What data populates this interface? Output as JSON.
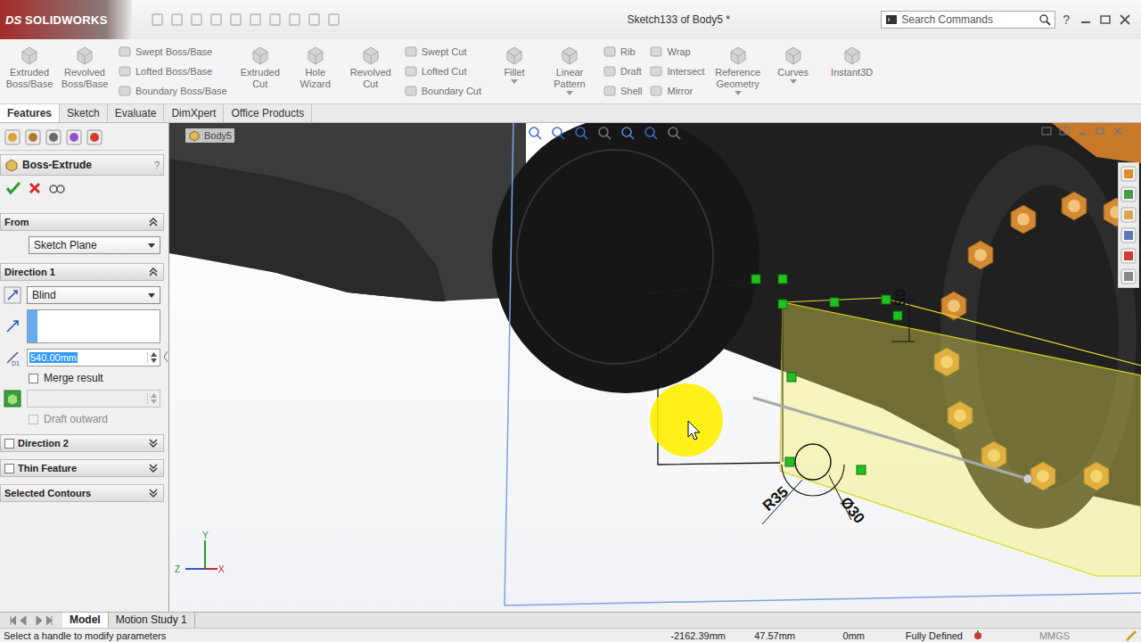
{
  "app": {
    "logo_mark": "DS",
    "logo": "SOLIDWORKS"
  },
  "window": {
    "title": "Sketch133 of Body5 *"
  },
  "search": {
    "placeholder": "Search Commands"
  },
  "help": "?",
  "ribbon": {
    "groups": [
      {
        "kind": "large",
        "items": [
          {
            "label": "Extruded Boss/Base",
            "disabled": true,
            "dropdown": false
          },
          {
            "label": "Revolved Boss/Base",
            "disabled": true,
            "dropdown": false
          }
        ]
      },
      {
        "kind": "stack",
        "items": [
          {
            "label": "Swept Boss/Base",
            "disabled": true,
            "dropdown": false
          },
          {
            "label": "Lofted Boss/Base",
            "disabled": true,
            "dropdown": false
          },
          {
            "label": "Boundary Boss/Base",
            "disabled": true,
            "dropdown": false
          }
        ]
      },
      {
        "kind": "large",
        "items": [
          {
            "label": "Extruded Cut",
            "disabled": true,
            "dropdown": false
          },
          {
            "label": "Hole Wizard",
            "disabled": true,
            "dropdown": false
          },
          {
            "label": "Revolved Cut",
            "disabled": true,
            "dropdown": false
          }
        ]
      },
      {
        "kind": "stack",
        "items": [
          {
            "label": "Swept Cut",
            "disabled": true,
            "dropdown": false
          },
          {
            "label": "Lofted Cut",
            "disabled": true,
            "dropdown": false
          },
          {
            "label": "Boundary Cut",
            "disabled": true,
            "dropdown": false
          }
        ]
      },
      {
        "kind": "large",
        "items": [
          {
            "label": "Fillet",
            "disabled": true,
            "dropdown": true
          },
          {
            "label": "Linear Pattern",
            "disabled": true,
            "dropdown": true
          }
        ]
      },
      {
        "kind": "stack",
        "items": [
          {
            "label": "Rib",
            "disabled": true,
            "dropdown": false
          },
          {
            "label": "Draft",
            "disabled": true,
            "dropdown": false
          },
          {
            "label": "Shell",
            "disabled": true,
            "dropdown": false
          }
        ]
      },
      {
        "kind": "stack",
        "items": [
          {
            "label": "Wrap",
            "disabled": true,
            "dropdown": false
          },
          {
            "label": "Intersect",
            "disabled": true,
            "dropdown": false
          },
          {
            "label": "Mirror",
            "disabled": true,
            "dropdown": false
          }
        ]
      },
      {
        "kind": "large",
        "items": [
          {
            "label": "Reference Geometry",
            "disabled": true,
            "dropdown": true
          },
          {
            "label": "Curves",
            "disabled": true,
            "dropdown": true
          }
        ]
      },
      {
        "kind": "large",
        "items": [
          {
            "label": "Instant3D",
            "disabled": true,
            "dropdown": false
          }
        ]
      }
    ]
  },
  "tabs": [
    {
      "label": "Features",
      "selected": true
    },
    {
      "label": "Sketch",
      "selected": false
    },
    {
      "label": "Evaluate",
      "selected": false
    },
    {
      "label": "DimXpert",
      "selected": false
    },
    {
      "label": "Office Products",
      "selected": false
    }
  ],
  "property_manager": {
    "title": "Boss-Extrude",
    "help": "?",
    "sections": [
      {
        "title": "From",
        "kind": "from",
        "expanded": true,
        "checkbox": false,
        "checked": false,
        "select": "Sketch Plane"
      },
      {
        "title": "Direction 1",
        "kind": "direction",
        "expanded": true,
        "checkbox": false,
        "checked": false,
        "type": "Blind",
        "direction_field": "",
        "depth": "540.00mm",
        "depth_selected": true,
        "merge": {
          "label": "Merge result",
          "checked": false,
          "disabled": false
        },
        "body_field": "",
        "draft": {
          "label": "Draft outward",
          "checked": false,
          "disabled": true
        }
      },
      {
        "title": "Direction 2",
        "kind": "collapsed",
        "expanded": false,
        "checkbox": true,
        "checked": false
      },
      {
        "title": "Thin Feature",
        "kind": "collapsed",
        "expanded": false,
        "checkbox": true,
        "checked": false
      },
      {
        "title": "Selected Contours",
        "kind": "collapsed",
        "expanded": false,
        "checkbox": false,
        "checked": false
      }
    ]
  },
  "viewport": {
    "tree_item": "Body5",
    "dimensions": [
      {
        "text": "50"
      },
      {
        "text": "R35"
      },
      {
        "text": "Ø30"
      }
    ],
    "triad": {
      "y": "Y",
      "z": "Z",
      "x": "X"
    }
  },
  "bottom_tabs": [
    {
      "label": "Model",
      "selected": true
    },
    {
      "label": "Motion Study 1",
      "selected": false
    }
  ],
  "status_bar": {
    "message": "Select a handle to modify parameters",
    "coords": [
      "-2162.39mm",
      "47.57mm",
      "0mm"
    ],
    "state": "Fully Defined",
    "units": "MMGS",
    "units_disabled": true
  }
}
